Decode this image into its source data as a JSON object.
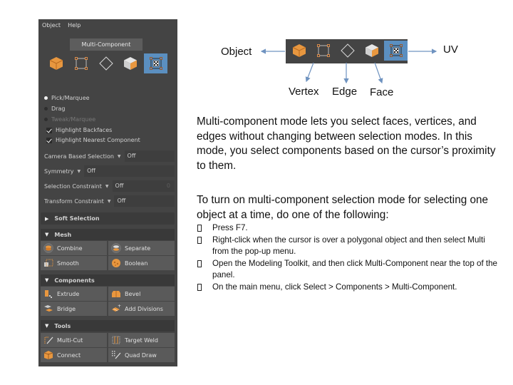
{
  "panel": {
    "menu": [
      "Object",
      "Help"
    ],
    "tooltip": "Multi-Component",
    "selection_modes": [
      "object",
      "vertex",
      "edge",
      "face",
      "multi-component"
    ],
    "active_mode": "multi-component",
    "radio_options": [
      {
        "label": "Pick/Marquee",
        "selected": true,
        "enabled": true
      },
      {
        "label": "Drag",
        "selected": false,
        "enabled": true
      },
      {
        "label": "Tweak/Marquee",
        "selected": false,
        "enabled": false
      }
    ],
    "checkboxes": [
      {
        "label": "Highlight Backfaces",
        "checked": true
      },
      {
        "label": "Highlight Nearest Component",
        "checked": true
      }
    ],
    "dropdowns": [
      {
        "label": "Camera Based Selection",
        "value": "Off"
      },
      {
        "label": "Symmetry",
        "value": "Off"
      },
      {
        "label": "Selection Constraint",
        "value": "Off",
        "number": "0"
      },
      {
        "label": "Transform Constraint",
        "value": "Off"
      }
    ],
    "soft_selection": "Soft Selection",
    "sections": [
      {
        "title": "Mesh",
        "buttons": [
          {
            "label": "Combine",
            "icon": "combine-icon"
          },
          {
            "label": "Separate",
            "icon": "separate-icon"
          },
          {
            "label": "Smooth",
            "icon": "smooth-icon"
          },
          {
            "label": "Boolean",
            "icon": "boolean-icon"
          }
        ]
      },
      {
        "title": "Components",
        "buttons": [
          {
            "label": "Extrude",
            "icon": "extrude-icon"
          },
          {
            "label": "Bevel",
            "icon": "bevel-icon"
          },
          {
            "label": "Bridge",
            "icon": "bridge-icon"
          },
          {
            "label": "Add Divisions",
            "icon": "add-divisions-icon"
          }
        ]
      },
      {
        "title": "Tools",
        "buttons": [
          {
            "label": "Multi-Cut",
            "icon": "multi-cut-icon"
          },
          {
            "label": "Target Weld",
            "icon": "target-weld-icon"
          },
          {
            "label": "Connect",
            "icon": "connect-icon"
          },
          {
            "label": "Quad Draw",
            "icon": "quad-draw-icon"
          }
        ]
      }
    ]
  },
  "diagram": {
    "labels": {
      "object": "Object",
      "uv": "UV",
      "vertex": "Vertex",
      "edge": "Edge",
      "face": "Face"
    },
    "arrow_color": "#6f93c0",
    "active_color": "#5b8fc0",
    "accent_orange": "#e8973f"
  },
  "text": {
    "paragraph1": "Multi-component mode lets you select faces, vertices, and edges without changing between selection modes. In this mode, you select components based on the cursor’s proximity to them.",
    "paragraph2": "To turn on multi-component selection mode for selecting one object at a time, do one of the following:",
    "bullets": [
      "Press F7.",
      "Right-click when the cursor is over a polygonal object and then select Multi from the pop-up menu.",
      "Open the Modeling Toolkit, and then click Multi-Component near the top of the panel.",
      "On the main menu, click Select > Components > Multi-Component."
    ]
  }
}
